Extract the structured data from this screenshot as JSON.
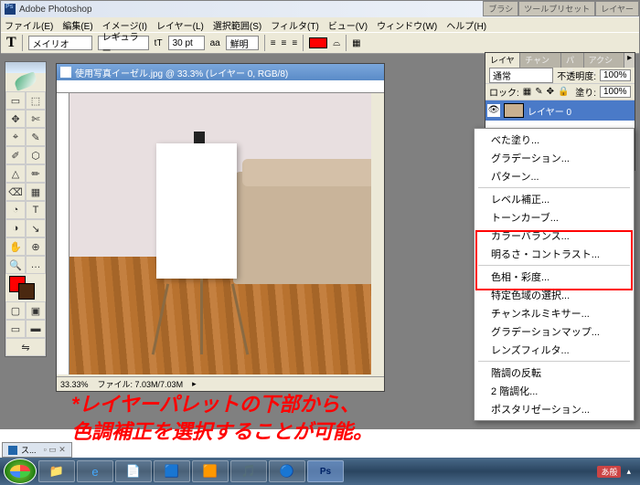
{
  "app": {
    "title": "Adobe Photoshop"
  },
  "menu": [
    "ファイル(E)",
    "編集(E)",
    "イメージ(I)",
    "レイヤー(L)",
    "選択範囲(S)",
    "フィルタ(T)",
    "ビュー(V)",
    "ウィンドウ(W)",
    "ヘルプ(H)"
  ],
  "options": {
    "font_family": "メイリオ",
    "font_style": "レギュラー",
    "font_size_prefix": "tT",
    "font_size": "30 pt",
    "aa_label": "aa",
    "aa_value": "鮮明"
  },
  "docked_tabs": [
    "ブラシ",
    "ツールプリセット",
    "レイヤー"
  ],
  "doc": {
    "title": "使用写真イーゼル.jpg @ 33.3% (レイヤー 0, RGB/8)",
    "zoom": "33.33%",
    "status": "ファイル: 7.03M/7.03M"
  },
  "layers": {
    "tabs": [
      "レイヤー",
      "チャンネル",
      "パス",
      "アクション"
    ],
    "blend_mode": "通常",
    "opacity_label": "不透明度:",
    "opacity_value": "100%",
    "lock_label": "ロック:",
    "fill_label": "塗り:",
    "fill_value": "100%",
    "layer0_name": "レイヤー 0"
  },
  "context_menu": {
    "g1": [
      "べた塗り...",
      "グラデーション...",
      "パターン..."
    ],
    "g2": [
      "レベル補正...",
      "トーンカーブ...",
      "カラーバランス...",
      "明るさ・コントラスト..."
    ],
    "g3": [
      "色相・彩度...",
      "特定色域の選択...",
      "チャンネルミキサー...",
      "グラデーションマップ...",
      "レンズフィルタ..."
    ],
    "g4": [
      "階調の反転",
      "2 階調化...",
      "ポスタリゼーション..."
    ]
  },
  "annotation": {
    "line1": "*レイヤーパレットの下部から、",
    "line2": "色調補正を選択することが可能。"
  },
  "taskbar": {
    "ss_tab": "ス...",
    "ime": "あ般"
  },
  "tool_glyphs": [
    "▭",
    "⬚",
    "✥",
    "✄",
    "⌖",
    "✎",
    "✐",
    "⬡",
    "△",
    "✏",
    "⌫",
    "▦",
    "◔",
    "T",
    "◑",
    "↘",
    "✋",
    "⊕",
    "🔍",
    "…"
  ]
}
